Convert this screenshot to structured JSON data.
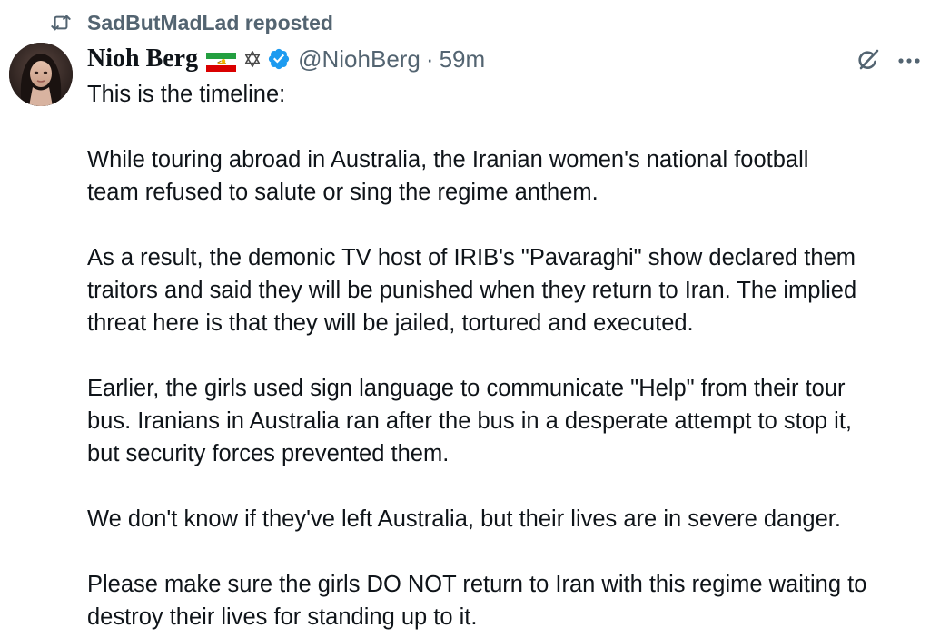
{
  "repost": {
    "icon": "repost-icon",
    "text": "SadButMadLad reposted"
  },
  "author": {
    "display_name": "Nioh Berg",
    "handle": "@NiohBerg",
    "separator": "·",
    "time": "59m",
    "icons": [
      "avatar",
      "iran-lion-sun-flag-icon",
      "star-of-david-icon",
      "verified-badge-icon"
    ]
  },
  "actions": {
    "grok_icon": "grok-icon",
    "more_icon": "more-options-icon"
  },
  "colors": {
    "text": "#0f1419",
    "secondary": "#536471",
    "verified": "#1d9bf0"
  },
  "tweet": {
    "paragraphs": [
      "This is the timeline:",
      "While touring abroad in Australia, the Iranian women's national football\nteam refused to salute or sing the regime anthem.",
      "As a result, the demonic TV host of IRIB's \"Pavaraghi\" show declared them\ntraitors and said they will be punished when they return to Iran. The implied\nthreat here is that they will be jailed, tortured and executed.",
      "Earlier, the girls used sign language to communicate \"Help\" from their tour\nbus. Iranians in Australia ran after the bus in a desperate attempt to stop it,\nbut security forces prevented them.",
      "We don't know if they've left Australia, but their lives are in severe danger.",
      "Please make sure the girls DO NOT return to Iran with this regime waiting to\ndestroy their lives for standing up to it."
    ]
  }
}
